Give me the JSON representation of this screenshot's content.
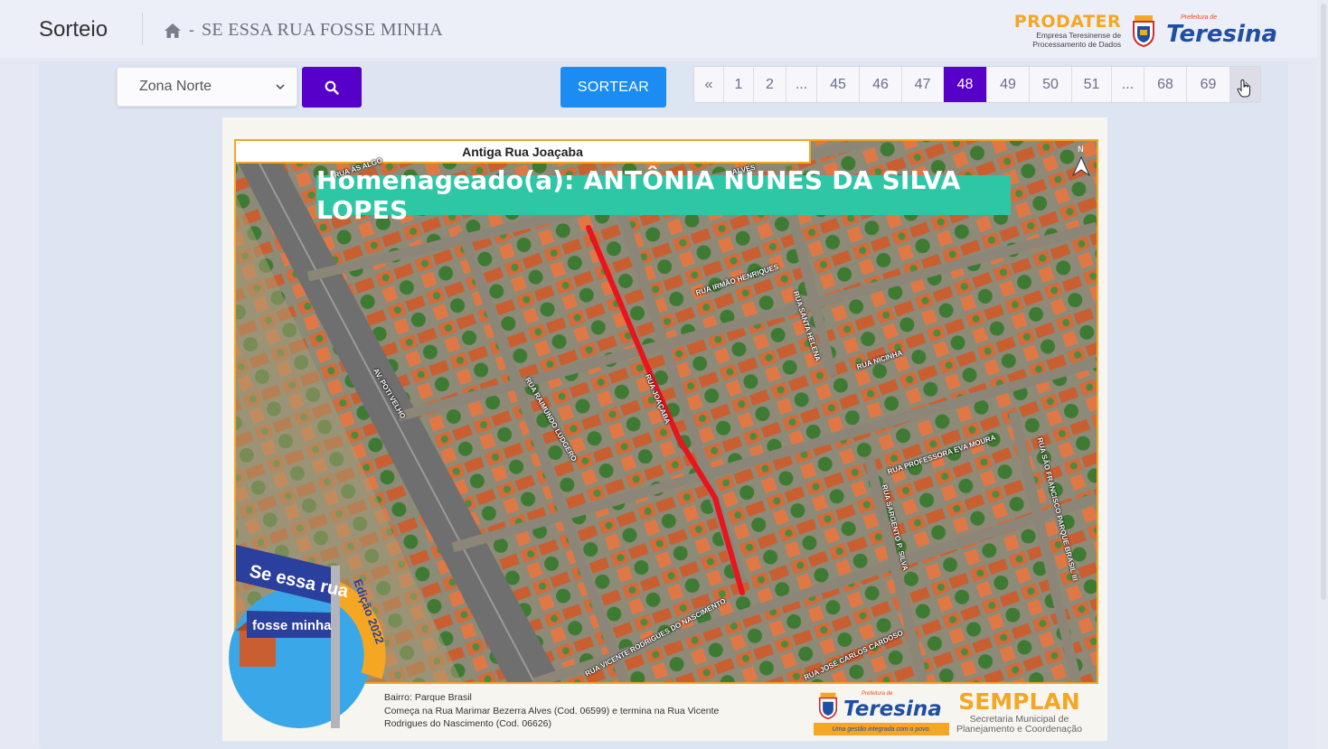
{
  "header": {
    "title": "Sorteio",
    "breadcrumb_sep": "-",
    "breadcrumb_text": "SE ESSA RUA FOSSE MINHA",
    "prodater_name": "PRODATER",
    "prodater_sub1": "Empresa Teresinense de",
    "prodater_sub2": "Processamento de Dados",
    "teresina_pre": "Prefeitura de",
    "teresina_name": "Teresina"
  },
  "controls": {
    "zone_value": "Zona Norte",
    "sortear_label": "SORTEAR"
  },
  "pagination": {
    "pages": [
      "«",
      "1",
      "2",
      "...",
      "45",
      "46",
      "47",
      "48",
      "49",
      "50",
      "51",
      "...",
      "68",
      "69",
      "»"
    ],
    "active": "48"
  },
  "poster": {
    "old_name": "Antiga Rua Joaçaba",
    "honoree": "Homenageado(a): ANTÔNIA NUNES DA SILVA LOPES",
    "streets": {
      "irmao": "RUA IRMÃO HENRIQUES",
      "santa_helena": "RUA SANTA HELENA",
      "nicinha": "RUA NICINHA",
      "joacaba": "RUA JOAÇABA",
      "raimundo": "RUA RAIMUNDO LUDGERO",
      "poti": "AV. POTI VELHO",
      "eva": "RUA PROFESSORA EVA MOURA",
      "sargento": "RUA SARGENTO P. SILVA",
      "sao_francisco": "RUA SÃO FRANCISCO PARQUE BRASIL III",
      "vicente": "RUA VICENTE RODRIGUES DO NASCIMENTO",
      "jose_carlos": "RUA JOSÉ CARLOS CARDOSO",
      "top_left": "RUA ÁS ALGO",
      "top_alves": "ALVES"
    },
    "badge_line1": "Se essa rua",
    "badge_line2": "fosse minha",
    "badge_edition": "Edição 2022",
    "footer_line1": "Bairro: Parque Brasil",
    "footer_line2": "Começa na Rua Marimar Bezerra Alves (Cod. 06599) e termina na Rua Vicente",
    "footer_line3": "Rodrigues do Nascimento (Cod. 06626)",
    "teresina_pre": "Prefeitura de",
    "teresina_name": "Teresina",
    "teresina_slogan": "Uma gestão integrada com o povo.",
    "semplan_name": "SEMPLAN",
    "semplan_sub1": "Secretaria Municipal de",
    "semplan_sub2": "Planejamento e Coordenação",
    "north": "N"
  },
  "colors": {
    "accent_purple": "#5600c9",
    "sortear_blue": "#1a8cf2",
    "honoree_teal": "#2ec7a6",
    "orange": "#f5a623",
    "street_red": "#e8141e"
  }
}
